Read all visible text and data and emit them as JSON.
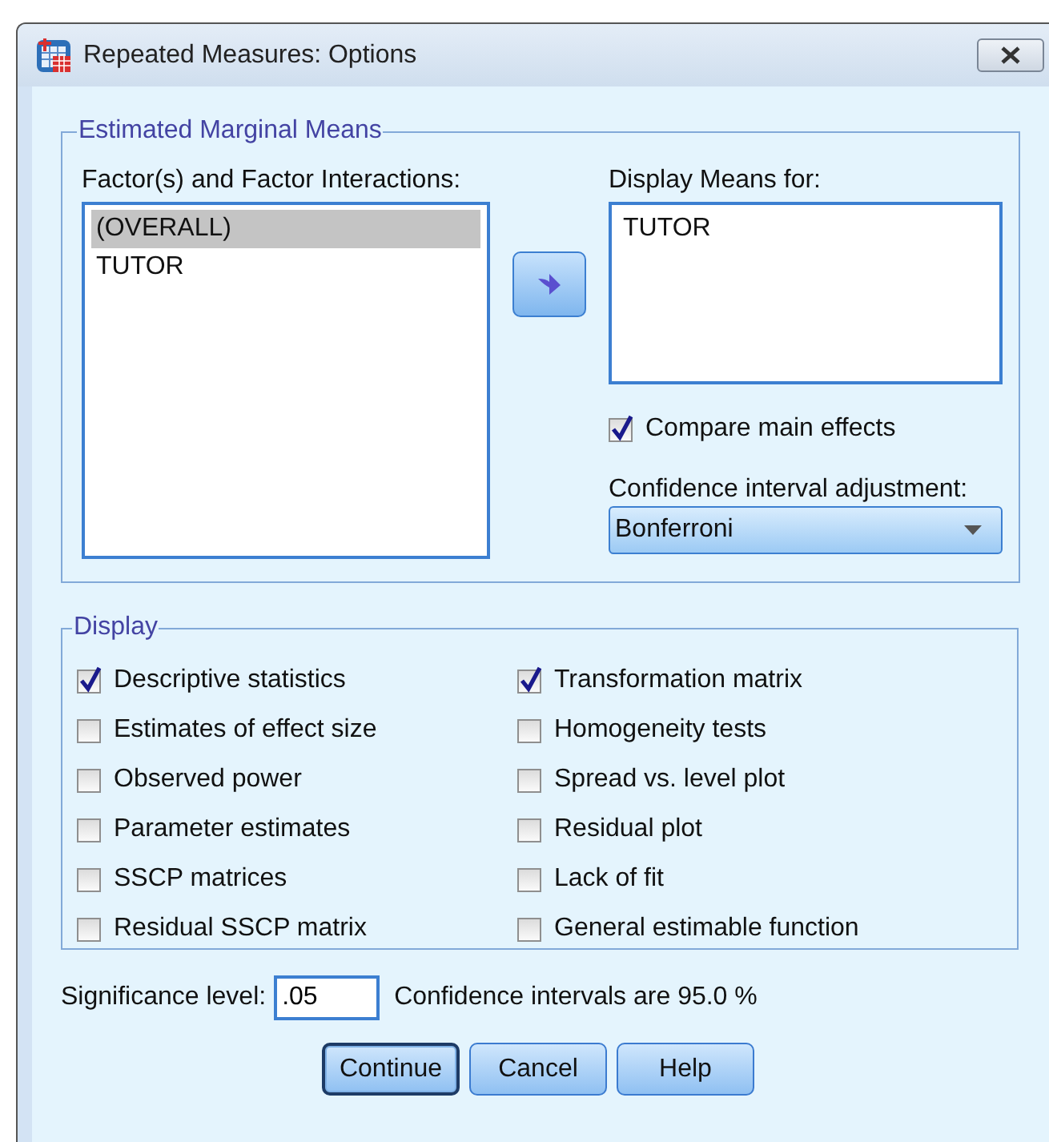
{
  "window": {
    "title": "Repeated Measures: Options"
  },
  "estimated_marginal_means": {
    "title": "Estimated Marginal Means",
    "factors": {
      "label": "Factor(s) and Factor Interactions:",
      "items": [
        {
          "text": "(OVERALL)",
          "selected": true
        },
        {
          "text": "TUTOR",
          "selected": false
        }
      ]
    },
    "display_means": {
      "label": "Display Means for:",
      "items": [
        {
          "text": "TUTOR",
          "selected": false
        }
      ]
    },
    "compare_main_effects": {
      "label": "Compare main effects",
      "checked": true
    },
    "ci_adjustment": {
      "label": "Confidence interval adjustment:",
      "value": "Bonferroni"
    }
  },
  "display": {
    "title": "Display",
    "options": [
      {
        "label": "Descriptive statistics",
        "checked": true
      },
      {
        "label": "Transformation matrix",
        "checked": true
      },
      {
        "label": "Estimates of effect size",
        "checked": false
      },
      {
        "label": "Homogeneity tests",
        "checked": false
      },
      {
        "label": "Observed power",
        "checked": false
      },
      {
        "label": "Spread vs. level plot",
        "checked": false
      },
      {
        "label": "Parameter estimates",
        "checked": false
      },
      {
        "label": "Residual plot",
        "checked": false
      },
      {
        "label": "SSCP matrices",
        "checked": false
      },
      {
        "label": "Lack of fit",
        "checked": false
      },
      {
        "label": "Residual SSCP matrix",
        "checked": false
      },
      {
        "label": "General estimable function",
        "checked": false
      }
    ]
  },
  "significance": {
    "label": "Significance level:",
    "value": ".05",
    "note": "Confidence intervals are 95.0 %"
  },
  "buttons": [
    {
      "label": "Continue",
      "default": true
    },
    {
      "label": "Cancel",
      "default": false
    },
    {
      "label": "Help",
      "default": false
    }
  ]
}
